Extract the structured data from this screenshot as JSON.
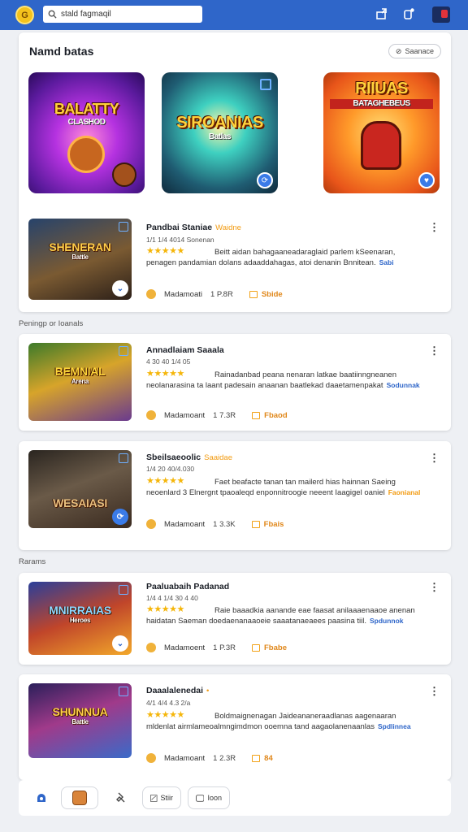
{
  "topbar": {
    "logo_glyph": "G",
    "search": {
      "value": "stald fagmaqil",
      "placeholder": "Search"
    },
    "icons": [
      "share-icon",
      "notifications-icon",
      "avatar"
    ]
  },
  "featured": {
    "title": "Namd batas",
    "see_all": "Saanace",
    "items": [
      {
        "title": "BALATTY",
        "subtitle": "CLASHOD",
        "bg": "purple"
      },
      {
        "title": "SIROANIAS",
        "subtitle": "Batlas",
        "bg": "teal"
      },
      {
        "title": "RIIUAS",
        "subtitle": "BATAGHEBEUS",
        "bg": "orange"
      }
    ]
  },
  "sections": {
    "popular": "Peningp or Ioanals",
    "recent": "Rarams"
  },
  "games": [
    {
      "name": "Pandbai Staniae",
      "tag": "Waidne",
      "meta": "1/1 1/4 4014 Sonenan",
      "stars": "★★★★★",
      "desc": "Beitt aidan bahagaaneadaraglaid parlem kSeenaran, penagen pandamian dolans adaaddahagas, atoi denanin Bnnitean.",
      "link": "Sabi",
      "link_color": "blue",
      "publisher": "Madamoati",
      "size": "1 P.8R",
      "action": "Sbide",
      "thumb_title": "SHENERAN",
      "thumb_sub": "Battle"
    },
    {
      "name": "Annadlaiam Saaala",
      "tag": "",
      "meta": "4 30 40 1/4 05",
      "stars": "★★★★★",
      "desc": "Rainadanbad peana nenaran latkae baatiinngneanen neolanarasina ta laant padesain anaanan baatlekad daaetamenpakat",
      "link": "Sodunnak",
      "link_color": "blue",
      "publisher": "Madamoant",
      "size": "1 7.3R",
      "action": "Fbaod",
      "thumb_title": "BEMNIAL",
      "thumb_sub": "Arena"
    },
    {
      "name": "Sbeilsaeoolic",
      "tag": "Saaidae",
      "meta": "1/4 20 40/4.030",
      "stars": "★★★★★",
      "desc": "Faet beafacte tanan tan mailerd hias hainnan Saeing neoenlard 3 Elnergnt tpaoaleqd enponnitroogie neeent Iaagigel oaniel",
      "link": "Faonianal",
      "link_color": "orange",
      "publisher": "Madamoant",
      "size": "1 3.3K",
      "action": "Fbais",
      "thumb_title": "WESAIASI",
      "thumb_sub": ""
    },
    {
      "name": "Paaluabaih Padanad",
      "tag": "",
      "meta": "1/4 4 1/4 30 4 40",
      "stars": "★★★★★",
      "desc": "Raie baaadkia aanande eae faasat anilaaaenaaoe anenan haidatan Saeman doedaenanaaoeie saaatanaeaees paasina tiil.",
      "link": "Spdunnok",
      "link_color": "blue",
      "publisher": "Madamoent",
      "size": "1 P.3R",
      "action": "Fbabe",
      "thumb_title": "MNIRRAIAS",
      "thumb_sub": "Heroes"
    },
    {
      "name": "Daaalalenedai",
      "tag": "",
      "meta": "4/1 4/4 4.3 2/a",
      "stars": "★★★★★",
      "desc": "Boldmaignenagan Jaideananeraadlanas aagenaaran mldenlat airmlameoalmngimdmon ooemna tand aagaolanenaanlas",
      "link": "Spdlinnea",
      "link_color": "blue",
      "publisher": "Madamoant",
      "size": "1 2.3R",
      "action": "84",
      "thumb_title": "SHUNNUA",
      "thumb_sub": "Battle"
    }
  ],
  "bottomnav": {
    "items": [
      {
        "icon": "home-icon",
        "label": ""
      },
      {
        "icon": "avatar",
        "label": ""
      },
      {
        "icon": "pin-icon",
        "label": ""
      },
      {
        "icon": "chart-icon",
        "label": "Stiir"
      },
      {
        "icon": "chat-icon",
        "label": "Ioon"
      }
    ]
  },
  "colors": {
    "topbar": "#2f66c9",
    "star": "#f5b60b",
    "accent_orange": "#f29b12",
    "accent_blue": "#2f66c9"
  }
}
